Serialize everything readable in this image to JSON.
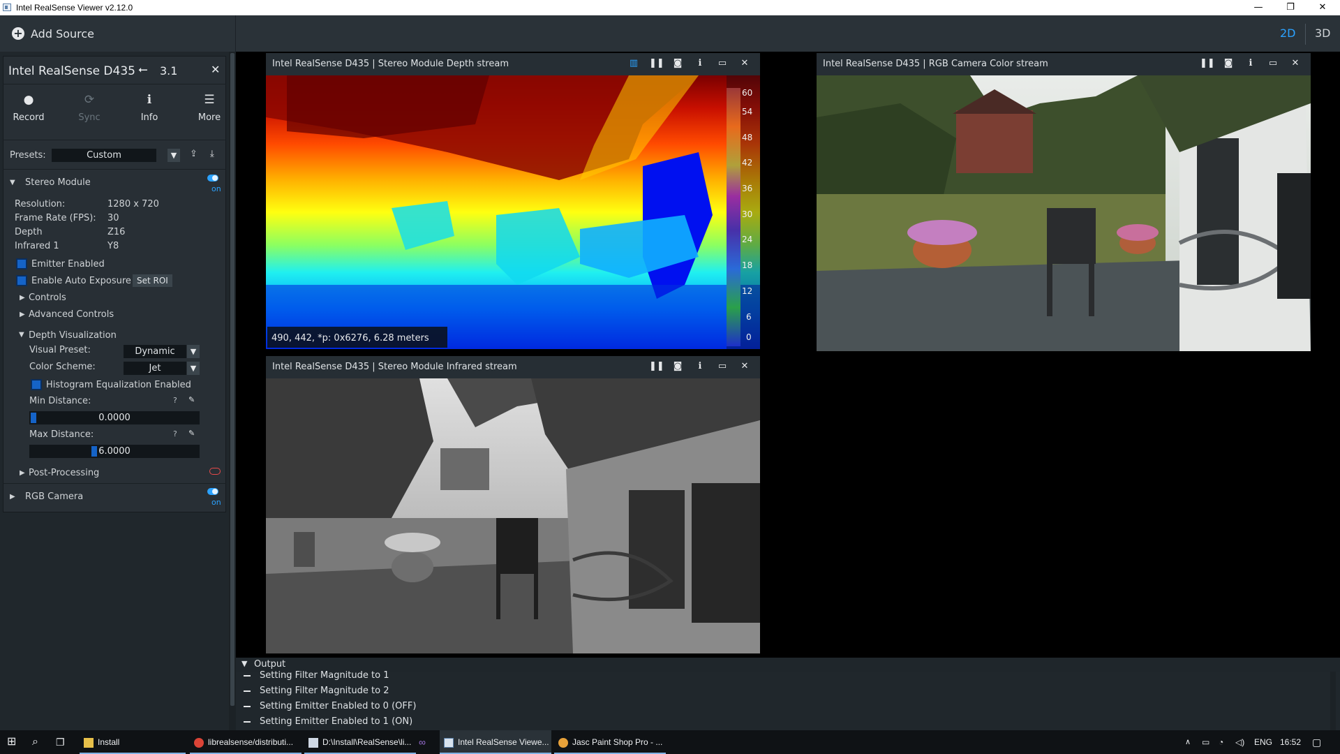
{
  "window": {
    "title": "Intel RealSense Viewer v2.12.0",
    "minimize": "—",
    "restore": "❐",
    "close": "✕"
  },
  "toolbar": {
    "add_source": "Add Source",
    "mode_2d": "2D",
    "mode_3d": "3D"
  },
  "device": {
    "name": "Intel RealSense D435",
    "usb": "3.1",
    "close": "✕",
    "actions": [
      {
        "label": "Record",
        "icon": "record-icon",
        "glyph": "●"
      },
      {
        "label": "Sync",
        "icon": "sync-icon",
        "glyph": "⟳"
      },
      {
        "label": "Info",
        "icon": "info-icon",
        "glyph": "ℹ"
      },
      {
        "label": "More",
        "icon": "menu-icon",
        "glyph": "☰"
      }
    ],
    "presets": {
      "label": "Presets:",
      "value": "Custom"
    }
  },
  "stereo_module": {
    "title": "Stereo Module",
    "on_label": "on",
    "props": [
      {
        "key": "Resolution:",
        "value": "1280 x 720"
      },
      {
        "key": "Frame Rate (FPS):",
        "value": "30"
      },
      {
        "key": "Depth",
        "value": "Z16"
      },
      {
        "key": "Infrared 1",
        "value": "Y8"
      }
    ],
    "emitter": "Emitter Enabled",
    "auto_exposure": "Enable Auto Exposure",
    "set_roi": "Set ROI",
    "controls": "Controls",
    "advanced": "Advanced Controls",
    "depth_vis": {
      "title": "Depth Visualization",
      "visual_preset_label": "Visual Preset:",
      "visual_preset": "Dynamic",
      "color_scheme_label": "Color Scheme:",
      "color_scheme": "Jet",
      "histogram": "Histogram Equalization Enabled",
      "min_label": "Min Distance:",
      "min_value": "0.0000",
      "min_fraction": 0.0,
      "max_label": "Max Distance:",
      "max_value": "6.0000",
      "max_fraction": 0.375
    },
    "post_processing": "Post-Processing"
  },
  "rgb_camera": {
    "title": "RGB Camera",
    "on_label": "on"
  },
  "streams": {
    "depth": {
      "title": "Intel RealSense D435 | Stereo Module Depth stream",
      "readout": "490, 442, *p: 0x6276, 6.28 meters",
      "scale": [
        "60",
        "54",
        "48",
        "42",
        "36",
        "30",
        "24",
        "18",
        "12",
        "6",
        "0"
      ]
    },
    "color": {
      "title": "Intel RealSense D435 | RGB Camera Color stream"
    },
    "infrared": {
      "title": "Intel RealSense D435 | Stereo Module Infrared stream"
    }
  },
  "output": {
    "title": "Output",
    "lines": [
      "Setting Filter Magnitude to 1",
      "Setting Filter Magnitude to 2",
      "Setting Emitter Enabled to 0 (OFF)",
      "Setting Emitter Enabled to 1 (ON)"
    ]
  },
  "taskbar": {
    "items": [
      "Install",
      "librealsense/distributi...",
      "D:\\Install\\RealSense\\li...",
      "Intel RealSense Viewe...",
      "Jasc Paint Shop Pro - ..."
    ],
    "lang": "ENG",
    "time": "16:52"
  },
  "colors": {
    "accent": "#2ba2ff",
    "checkbox": "#1563c7",
    "panel": "#282f35",
    "header": "#262e34"
  }
}
